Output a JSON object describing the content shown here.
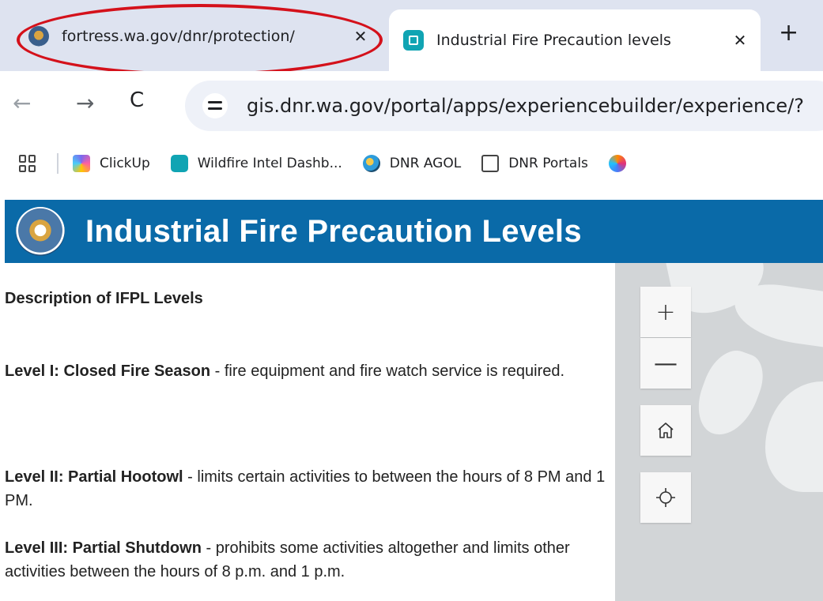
{
  "browser": {
    "tabs": [
      {
        "title": "fortress.wa.gov/dnr/protection/",
        "active": false,
        "favicon": "wa-seal-icon"
      },
      {
        "title": "Industrial Fire Precaution levels",
        "active": true,
        "favicon": "experience-builder-icon"
      }
    ],
    "close_glyph": "✕",
    "new_tab_glyph": "+",
    "url": "gis.dnr.wa.gov/portal/apps/experiencebuilder/experience/?",
    "nav": {
      "back": "←",
      "forward": "→",
      "reload": "C"
    },
    "bookmarks": [
      {
        "label": "ClickUp",
        "icon": "clickup-icon"
      },
      {
        "label": "Wildfire Intel Dashb...",
        "icon": "experience-builder-icon"
      },
      {
        "label": "DNR AGOL",
        "icon": "globe-icon"
      },
      {
        "label": "DNR Portals",
        "icon": "folder-icon"
      }
    ],
    "highlight_color": "#d4111b"
  },
  "app": {
    "title": "Industrial Fire Precaution Levels",
    "header_color": "#0a6aa8"
  },
  "content": {
    "heading": "Description of IFPL Levels",
    "levels": [
      {
        "name": "Level I: Closed Fire Season",
        "text": " - fire equipment and fire watch service is required."
      },
      {
        "name": "Level II: Partial Hootowl",
        "text": " - limits certain activities to between the hours of 8 PM and 1 PM."
      },
      {
        "name": "Level III: Partial Shutdown",
        "text": " - prohibits some activities altogether and limits other activities between the hours of 8 p.m. and 1 p.m."
      }
    ]
  },
  "map": {
    "zoom_in": "+",
    "zoom_out": "—",
    "home_icon": "home-icon",
    "locate_icon": "locate-icon"
  }
}
